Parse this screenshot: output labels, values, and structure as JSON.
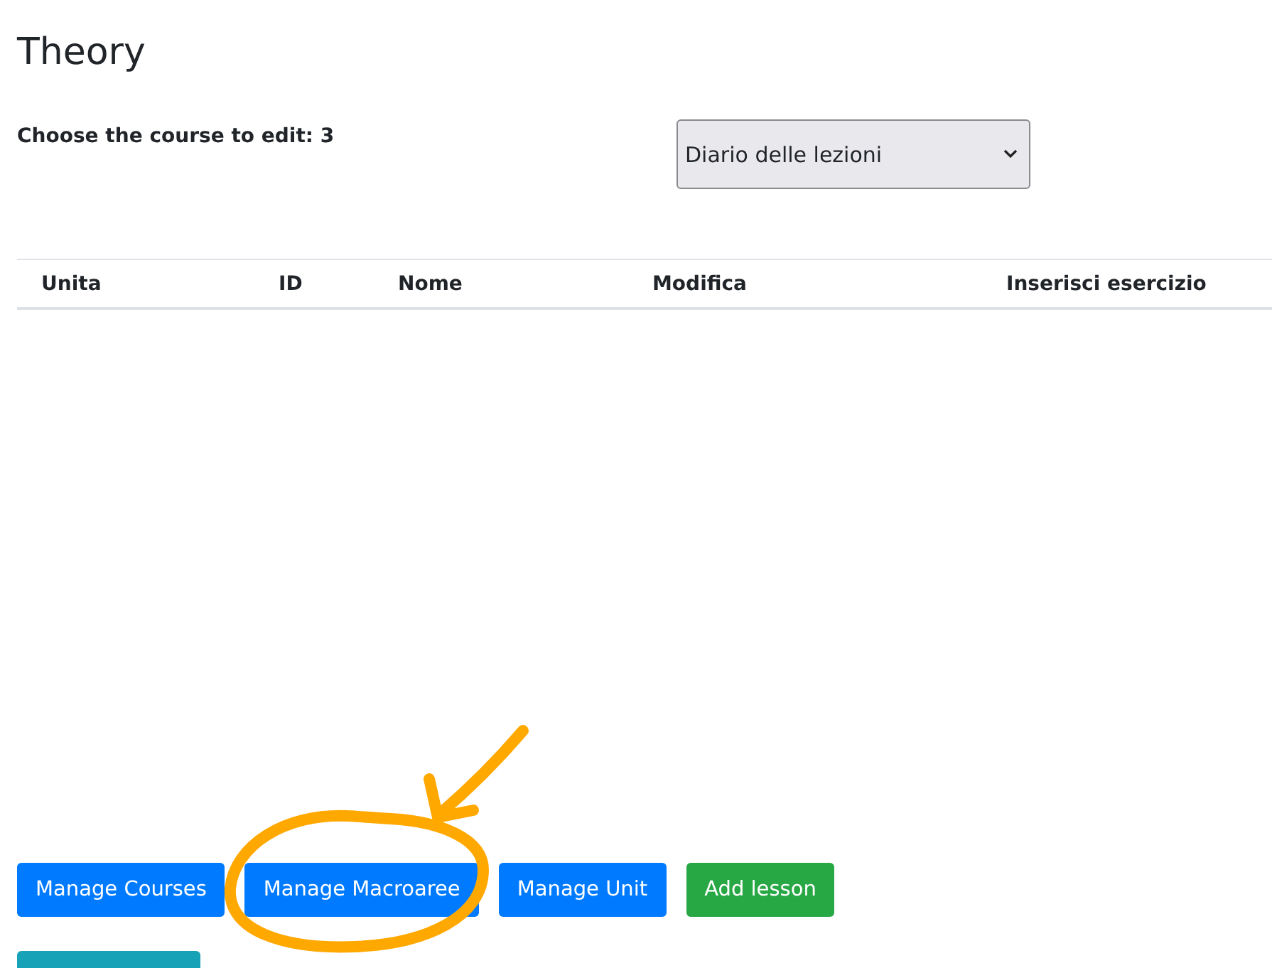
{
  "title": "Theory",
  "course_picker": {
    "label": "Choose the course to edit: 3",
    "value": "Diario delle lezioni"
  },
  "table": {
    "columns": [
      "Unita",
      "ID",
      "Nome",
      "Modifica",
      "Inserisci esercizio"
    ]
  },
  "buttons": [
    {
      "label": "Manage Courses",
      "kind": "primary"
    },
    {
      "label": "Manage Macroaree",
      "kind": "primary"
    },
    {
      "label": "Manage Unit",
      "kind": "primary"
    },
    {
      "label": "Add lesson",
      "kind": "success"
    }
  ],
  "extra_buttons": [
    {
      "kind": "info"
    }
  ],
  "annotation": {
    "kind": "circle-and-arrow"
  }
}
